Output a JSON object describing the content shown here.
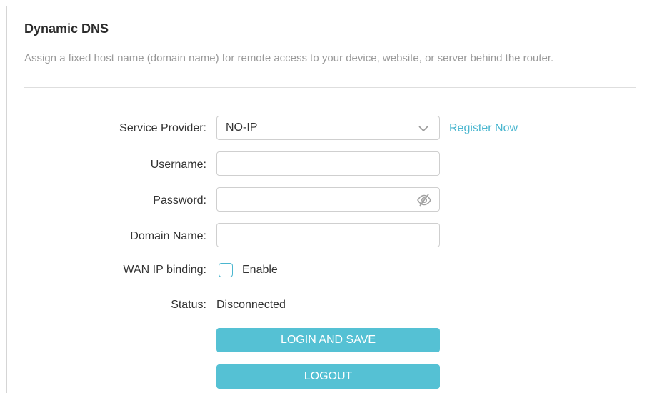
{
  "section": {
    "title": "Dynamic DNS",
    "description": "Assign a fixed host name (domain name) for remote access to your device, website, or server behind the router."
  },
  "form": {
    "service_provider": {
      "label": "Service Provider:",
      "selected": "NO-IP",
      "register_link": "Register Now"
    },
    "username": {
      "label": "Username:",
      "value": ""
    },
    "password": {
      "label": "Password:",
      "value": ""
    },
    "domain_name": {
      "label": "Domain Name:",
      "value": ""
    },
    "wan_ip_binding": {
      "label": "WAN IP binding:",
      "checkbox_label": "Enable",
      "checked": false
    },
    "status": {
      "label": "Status:",
      "value": "Disconnected"
    }
  },
  "buttons": {
    "login_save": "LOGIN AND SAVE",
    "logout": "LOGOUT"
  },
  "colors": {
    "accent": "#4ab6cf",
    "button_bg": "#55c1d4",
    "muted_text": "#999999"
  },
  "icons": {
    "dropdown": "chevron-down-icon",
    "password_toggle": "eye-off-icon"
  }
}
